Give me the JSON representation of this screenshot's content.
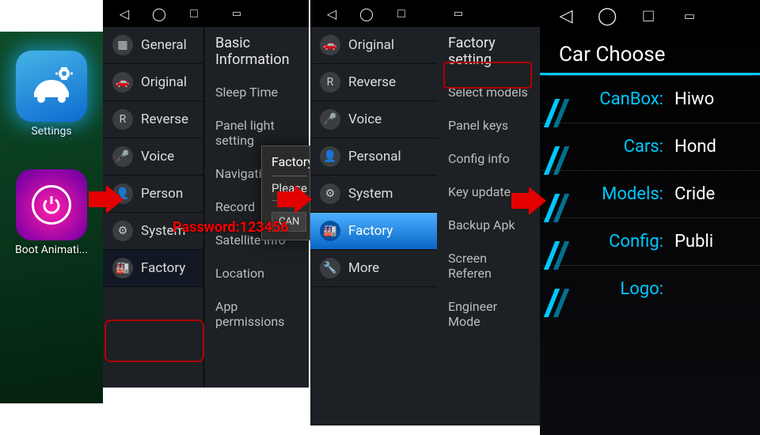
{
  "home": {
    "settings_label": "Settings",
    "boot_label": "Boot Animati..."
  },
  "nav_glyphs": {
    "back": "◁",
    "home": "◯",
    "recent": "□",
    "gallery": "▭"
  },
  "stage2": {
    "menu": [
      {
        "icon": "▦",
        "label": "General"
      },
      {
        "icon": "🚗",
        "label": "Original"
      },
      {
        "icon": "R",
        "label": "Reverse"
      },
      {
        "icon": "🎤",
        "label": "Voice"
      },
      {
        "icon": "👤",
        "label": "Person"
      },
      {
        "icon": "⚙",
        "label": "System"
      },
      {
        "icon": "🏭",
        "label": "Factory"
      }
    ],
    "detail_header": "Basic Information",
    "detail_items": [
      "Sleep Time",
      "Panel light setting",
      "Navigation",
      "Record",
      "Satellite info",
      "Location",
      "App permissions"
    ],
    "dialog": {
      "title": "Factory",
      "body": "Please",
      "cancel": "CAN"
    },
    "password_overlay": "Password:123456"
  },
  "stage3": {
    "menu": [
      {
        "icon": "🚗",
        "label": "Original"
      },
      {
        "icon": "R",
        "label": "Reverse"
      },
      {
        "icon": "🎤",
        "label": "Voice"
      },
      {
        "icon": "👤",
        "label": "Personal"
      },
      {
        "icon": "⚙",
        "label": "System"
      },
      {
        "icon": "🏭",
        "label": "Factory"
      },
      {
        "icon": "🔧",
        "label": "More"
      }
    ],
    "selected_index": 5
  },
  "stage4": {
    "header": "Factory setting",
    "items": [
      "Select models",
      "Panel keys",
      "Config info",
      "Key update",
      "Backup Apk",
      "Screen Referen",
      "Engineer Mode"
    ]
  },
  "stage5": {
    "title": "Car Choose",
    "fields": [
      {
        "key": "CanBox:",
        "val": "Hiwo"
      },
      {
        "key": "Cars:",
        "val": "Hond"
      },
      {
        "key": "Models:",
        "val": "Cride"
      },
      {
        "key": "Config:",
        "val": "Publi"
      },
      {
        "key": "Logo:",
        "val": ""
      }
    ]
  }
}
